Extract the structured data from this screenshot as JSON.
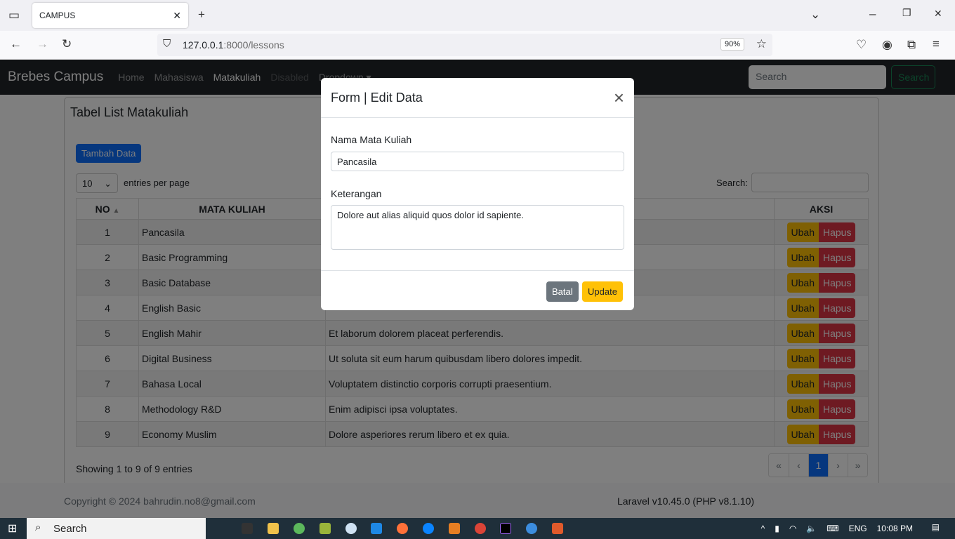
{
  "browser": {
    "tab_title": "CAMPUS",
    "url_host": "127.0.0.1",
    "url_rest": ":8000/lessons",
    "zoom": "90%"
  },
  "nav": {
    "brand": "Brebes Campus",
    "links": [
      "Home",
      "Mahasiswa",
      "Matakuliah",
      "Disabled",
      "Dropdown ▾"
    ],
    "search_placeholder": "Search",
    "search_button": "Search"
  },
  "card": {
    "title": "Tabel List Matakuliah",
    "add_button": "Tambah Data",
    "entries_value": "10",
    "entries_label": "entries per page",
    "search_label": "Search:",
    "headers": {
      "no": "NO",
      "mk": "MATA KULIAH",
      "aksi": "AKSI"
    },
    "rows": [
      {
        "no": "1",
        "mk": "Pancasila",
        "ket": ""
      },
      {
        "no": "2",
        "mk": "Basic Programming",
        "ket": ""
      },
      {
        "no": "3",
        "mk": "Basic Database",
        "ket": ""
      },
      {
        "no": "4",
        "mk": "English Basic",
        "ket": ""
      },
      {
        "no": "5",
        "mk": "English Mahir",
        "ket": "Et laborum dolorem placeat perferendis."
      },
      {
        "no": "6",
        "mk": "Digital Business",
        "ket": "Ut soluta sit eum harum quibusdam libero dolores impedit."
      },
      {
        "no": "7",
        "mk": "Bahasa Local",
        "ket": "Voluptatem distinctio corporis corrupti praesentium."
      },
      {
        "no": "8",
        "mk": "Methodology R&D",
        "ket": "Enim adipisci ipsa voluptates."
      },
      {
        "no": "9",
        "mk": "Economy Muslim",
        "ket": "Dolore asperiores rerum libero et ex quia."
      }
    ],
    "edit_label": "Ubah",
    "delete_label": "Hapus",
    "showing": "Showing 1 to 9 of 9 entries",
    "pages": [
      "«",
      "‹",
      "1",
      "›",
      "»"
    ]
  },
  "footer": {
    "copyright": "Copyright © 2024 bahrudin.no8@gmail.com",
    "version": "Laravel v10.45.0 (PHP v8.1.10)"
  },
  "modal": {
    "title": "Form | Edit Data",
    "name_label": "Nama Mata Kuliah",
    "name_value": "Pancasila",
    "desc_label": "Keterangan",
    "desc_value": "Dolore aut alias aliquid quos dolor id sapiente.",
    "cancel": "Batal",
    "update": "Update"
  },
  "taskbar": {
    "search": "Search",
    "lang": "ENG",
    "time": "10:08 PM"
  }
}
